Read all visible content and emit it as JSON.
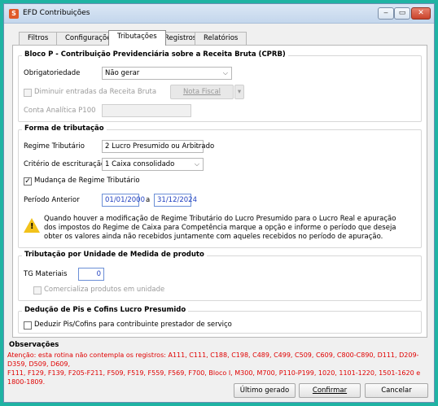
{
  "window": {
    "title": "EFD Contribuições",
    "app_icon": "efd-app-icon",
    "controls": {
      "minimize": "‒",
      "maximize": "▭",
      "close": "✕"
    }
  },
  "tabs": [
    {
      "label": "Filtros",
      "active": false
    },
    {
      "label": "Configurações",
      "active": false
    },
    {
      "label": "Tributações",
      "active": true
    },
    {
      "label": "Registros",
      "active": false
    },
    {
      "label": "Relatórios",
      "active": false
    }
  ],
  "bloco_p": {
    "title": "Bloco P - Contribuição Previdenciária sobre a Receita Bruta (CPRB)",
    "obrigatoriedade_label": "Obrigatoriedade",
    "obrigatoriedade_value": "Não gerar",
    "diminuir_label": "Diminuir entradas da Receita Bruta",
    "nota_fiscal_label": "Nota Fiscal",
    "conta_label": "Conta Analítica P100",
    "conta_value": ""
  },
  "forma": {
    "title": "Forma de tributação",
    "regime_label": "Regime Tributário",
    "regime_value": "2 Lucro Presumido ou Arbitrado",
    "criterio_label": "Critério de escrituração",
    "criterio_value": "1 Caixa consolidado",
    "mudanca_label": "Mudança de Regime Tributário",
    "mudanca_checked": true,
    "periodo_label": "Período Anterior",
    "periodo_inicio": "01/01/2000",
    "periodo_sep": "a",
    "periodo_fim": "31/12/2024",
    "aviso_line1": "Quando houver a modificação de Regime Tributário do Lucro Presumido para o Lucro Real e apuração",
    "aviso_line2": "dos impostos do Regime de Caixa para Competência marque a opção e informe o período que deseja",
    "aviso_line3": "obter os valores ainda não recebidos juntamente com aqueles recebidos no período de apuração."
  },
  "unidade": {
    "title": "Tributação por Unidade de Medida de produto",
    "tg_label": "TG Materiais",
    "tg_value": "0",
    "comercializa_label": "Comercializa produtos em unidade"
  },
  "deducao": {
    "title": "Dedução de Pis e Cofins Lucro Presumido",
    "deduzir_label": "Deduzir Pis/Cofins para contribuinte prestador de serviço"
  },
  "observacoes": {
    "title": "Observações",
    "line1": "Atenção: esta rotina não contempla os registros: A111, C111, C188, C198, C489, C499, C509, C609, C800-C890, D111, D209-D359, D509, D609,",
    "line2": "F111, F129, F139, F205-F211, F509, F519, F559, F569, F700, Bloco I, M300, M700, P110-P199, 1020, 1101-1220, 1501-1620 e 1800-1809."
  },
  "footer": {
    "ultimo_label": "Último gerado",
    "confirmar_label": "Confirmar",
    "cancelar_label": "Cancelar"
  }
}
